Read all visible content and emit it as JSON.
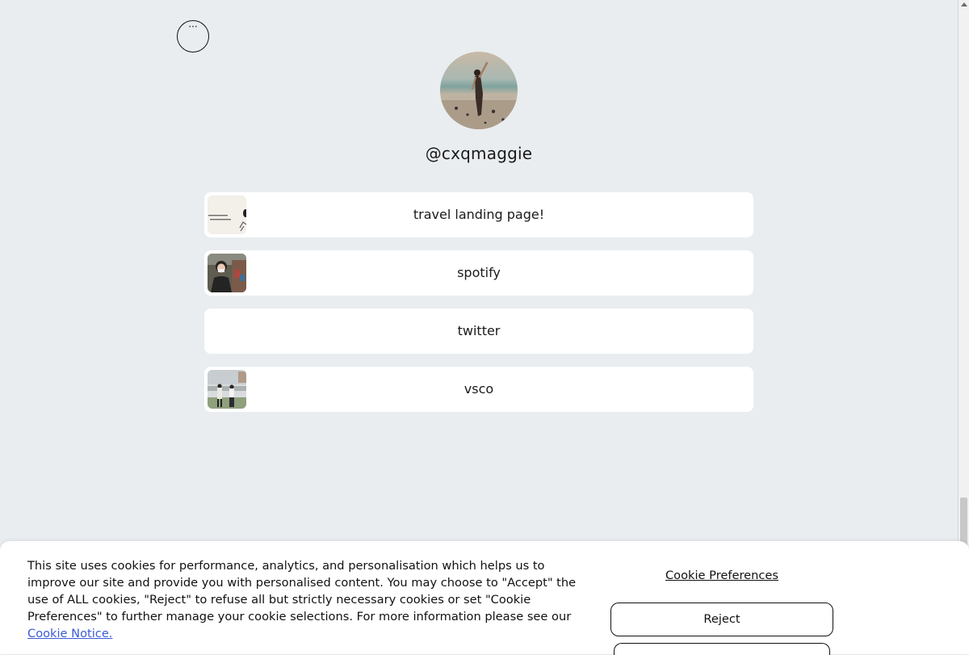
{
  "profile": {
    "username": "@cxqmaggie",
    "more_icon": "ellipsis-icon"
  },
  "links": [
    {
      "label": "travel landing page!",
      "has_thumb": true
    },
    {
      "label": "spotify",
      "has_thumb": true
    },
    {
      "label": "twitter",
      "has_thumb": false
    },
    {
      "label": "vsco",
      "has_thumb": true
    }
  ],
  "cookie_banner": {
    "message": "This site uses cookies for performance, analytics, and personalisation which helps us to improve our site and provide you with personalised content. You may choose to \"Accept\" the use of ALL cookies, \"Reject\" to refuse all but strictly necessary cookies or set \"Cookie Preferences\" to further manage your cookie selections. For more information please see our",
    "notice_link": "Cookie Notice.",
    "preferences_label": "Cookie Preferences",
    "reject_label": "Reject"
  },
  "colors": {
    "background": "#e9edf0",
    "card": "#ffffff",
    "link": "#3b5bd6"
  }
}
